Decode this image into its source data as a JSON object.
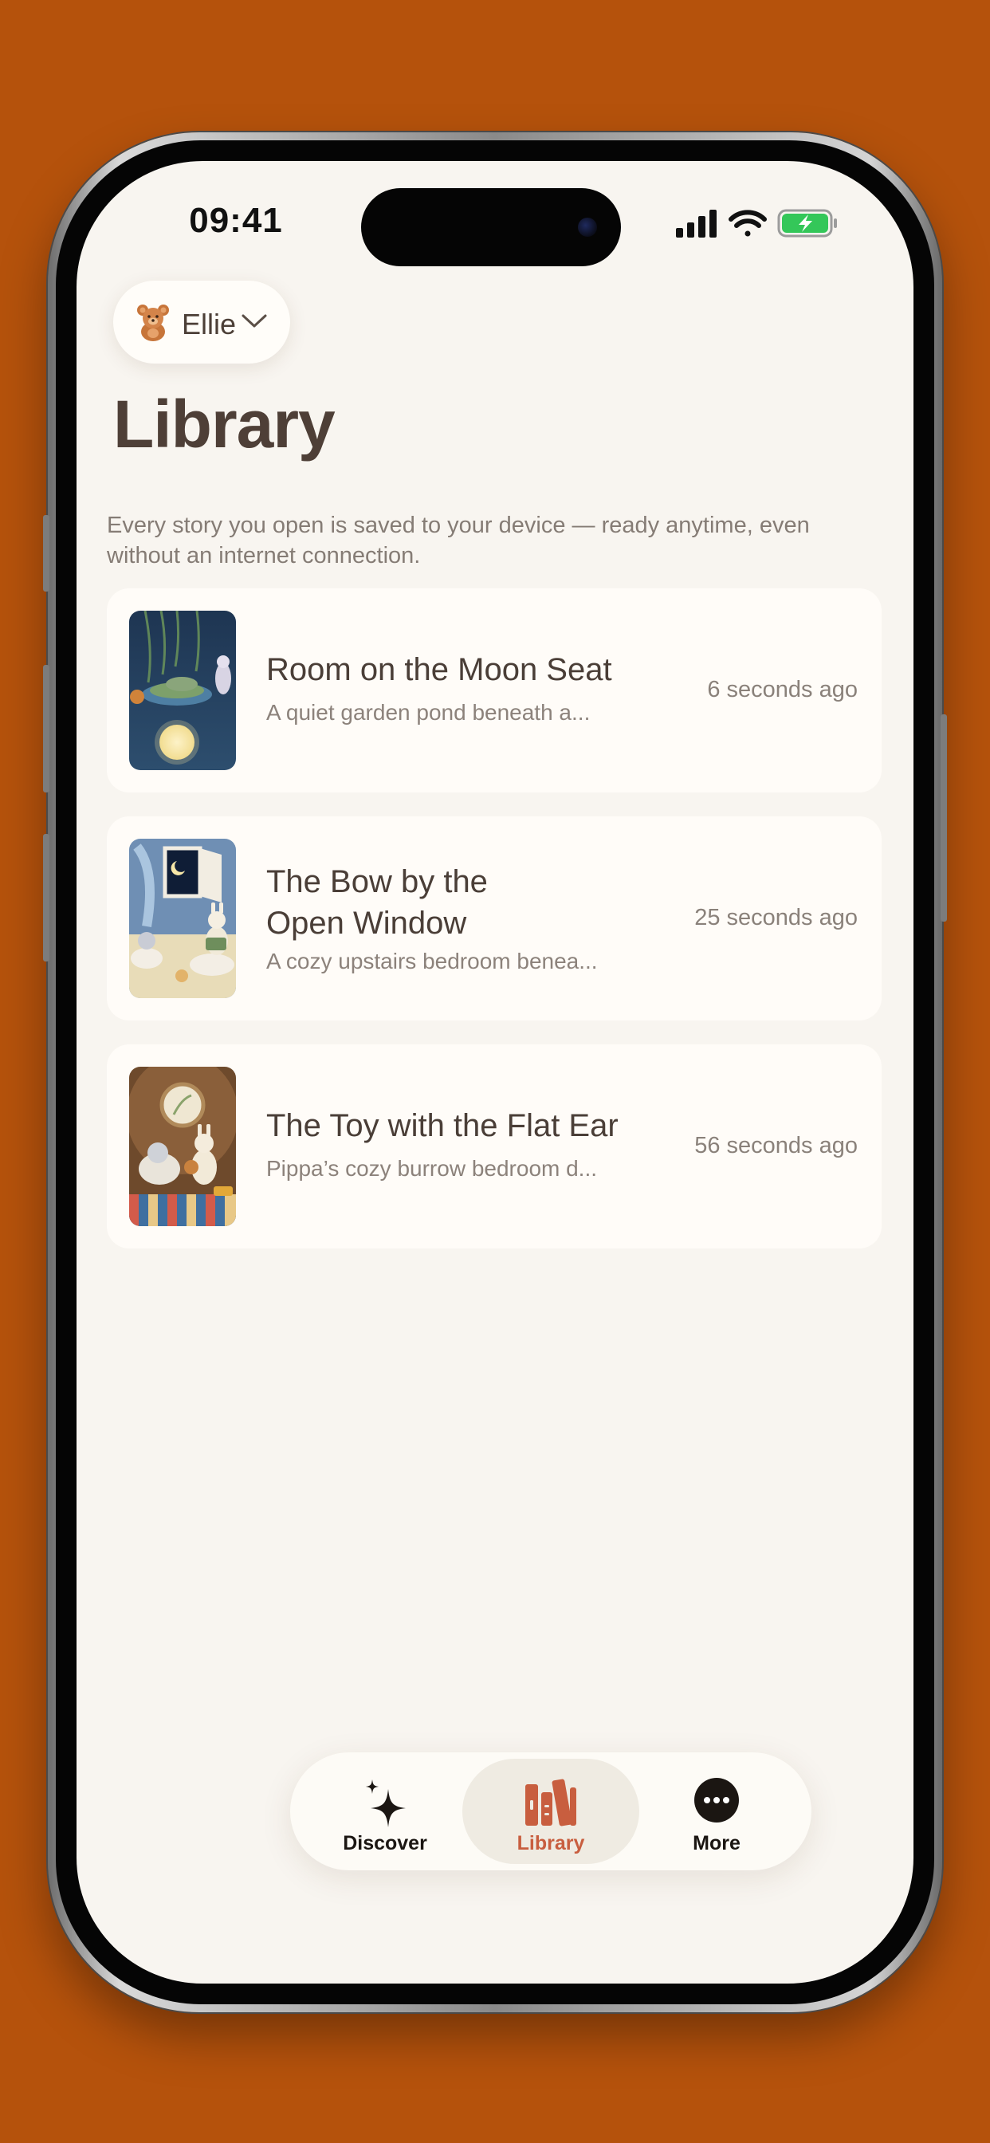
{
  "status_bar": {
    "time": "09:41",
    "icons": [
      "signal-icon",
      "wifi-icon",
      "battery-charging-icon"
    ]
  },
  "profile": {
    "icon": "teddy-bear-icon",
    "name": "Ellie"
  },
  "page": {
    "title": "Library",
    "description": "Every story you open is saved to your device — ready anytime, even without an internet connection."
  },
  "stories": [
    {
      "title": "Room on the Moon Seat",
      "subtitle": "A quiet garden pond beneath a...",
      "time": "6 seconds ago"
    },
    {
      "title": "The Bow by the Open Window",
      "subtitle": "A cozy upstairs bedroom benea...",
      "time": "25 seconds ago"
    },
    {
      "title": "The Toy with the Flat Ear",
      "subtitle": "Pippa’s cozy burrow bedroom d...",
      "time": "56 seconds ago"
    }
  ],
  "tabbar": {
    "tabs": [
      {
        "label": "Discover",
        "icon": "sparkles-icon",
        "active": false
      },
      {
        "label": "Library",
        "icon": "books-icon",
        "active": true
      },
      {
        "label": "More",
        "icon": "more-icon",
        "active": false
      }
    ]
  },
  "colors": {
    "background": "#b5520c",
    "accent": "#c85e3f",
    "title": "#4e3f37",
    "screen": "#f8f5f0"
  }
}
